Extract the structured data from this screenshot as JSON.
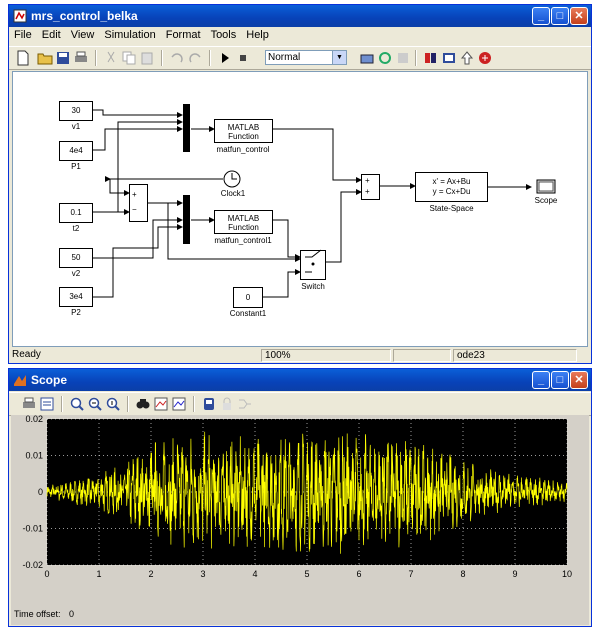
{
  "model_window": {
    "title": "mrs_control_belka",
    "menu": [
      "File",
      "Edit",
      "View",
      "Simulation",
      "Format",
      "Tools",
      "Help"
    ],
    "sim_mode": "Normal",
    "status": {
      "left": "Ready",
      "zoom": "100%",
      "solver": "ode23"
    },
    "blocks": {
      "v1_value": "30",
      "v1_label": "v1",
      "P1_value": "4e4",
      "P1_label": "P1",
      "t2_value": "0.1",
      "t2_label": "t2",
      "v2_value": "50",
      "v2_label": "v2",
      "P2_value": "3e4",
      "P2_label": "P2",
      "const_value": "0",
      "const_label": "Constant1",
      "fcn1_line1": "MATLAB",
      "fcn1_line2": "Function",
      "fcn1_label": "matfun_control",
      "fcn2_line1": "MATLAB",
      "fcn2_line2": "Function",
      "fcn2_label": "matfun_control1",
      "clock_label": "Clock1",
      "switch_label": "Switch",
      "ss_line1": "x' = Ax+Bu",
      "ss_line2": "y = Cx+Du",
      "ss_label": "State-Space",
      "scope_label": "Scope",
      "sum1_plus": "+",
      "sum1_minus": "−",
      "sum2_plus1": "+",
      "sum2_plus2": "+"
    }
  },
  "scope_window": {
    "title": "Scope",
    "time_offset_label": "Time offset:",
    "time_offset_value": "0",
    "chart_data": {
      "type": "line",
      "xlim": [
        0,
        10
      ],
      "ylim": [
        -0.02,
        0.02
      ],
      "xticks": [
        "0",
        "1",
        "2",
        "3",
        "4",
        "5",
        "6",
        "7",
        "8",
        "9",
        "10"
      ],
      "yticks": [
        "0.02",
        "0.01",
        "0",
        "-0.01",
        "-0.02"
      ],
      "grid": true,
      "background": "#000000",
      "line_color": "#ffff00",
      "envelope_x": [
        0,
        0.5,
        1,
        1.5,
        2,
        2.5,
        3,
        3.5,
        4,
        4.5,
        5,
        5.5,
        6,
        6.5,
        7,
        7.5,
        8,
        8.5,
        9,
        9.5,
        10
      ],
      "envelope_amp": [
        0.0015,
        0.0025,
        0.004,
        0.007,
        0.011,
        0.012,
        0.013,
        0.012,
        0.012,
        0.013,
        0.013,
        0.014,
        0.013,
        0.012,
        0.012,
        0.01,
        0.007,
        0.005,
        0.004,
        0.003,
        0.002
      ]
    }
  },
  "colors": {
    "titlebar": "#0842b8",
    "window_bg": "#ece9d8",
    "plot_bg": "#000000",
    "signal": "#ffff00",
    "axes_panel": "#d4d0c8"
  }
}
